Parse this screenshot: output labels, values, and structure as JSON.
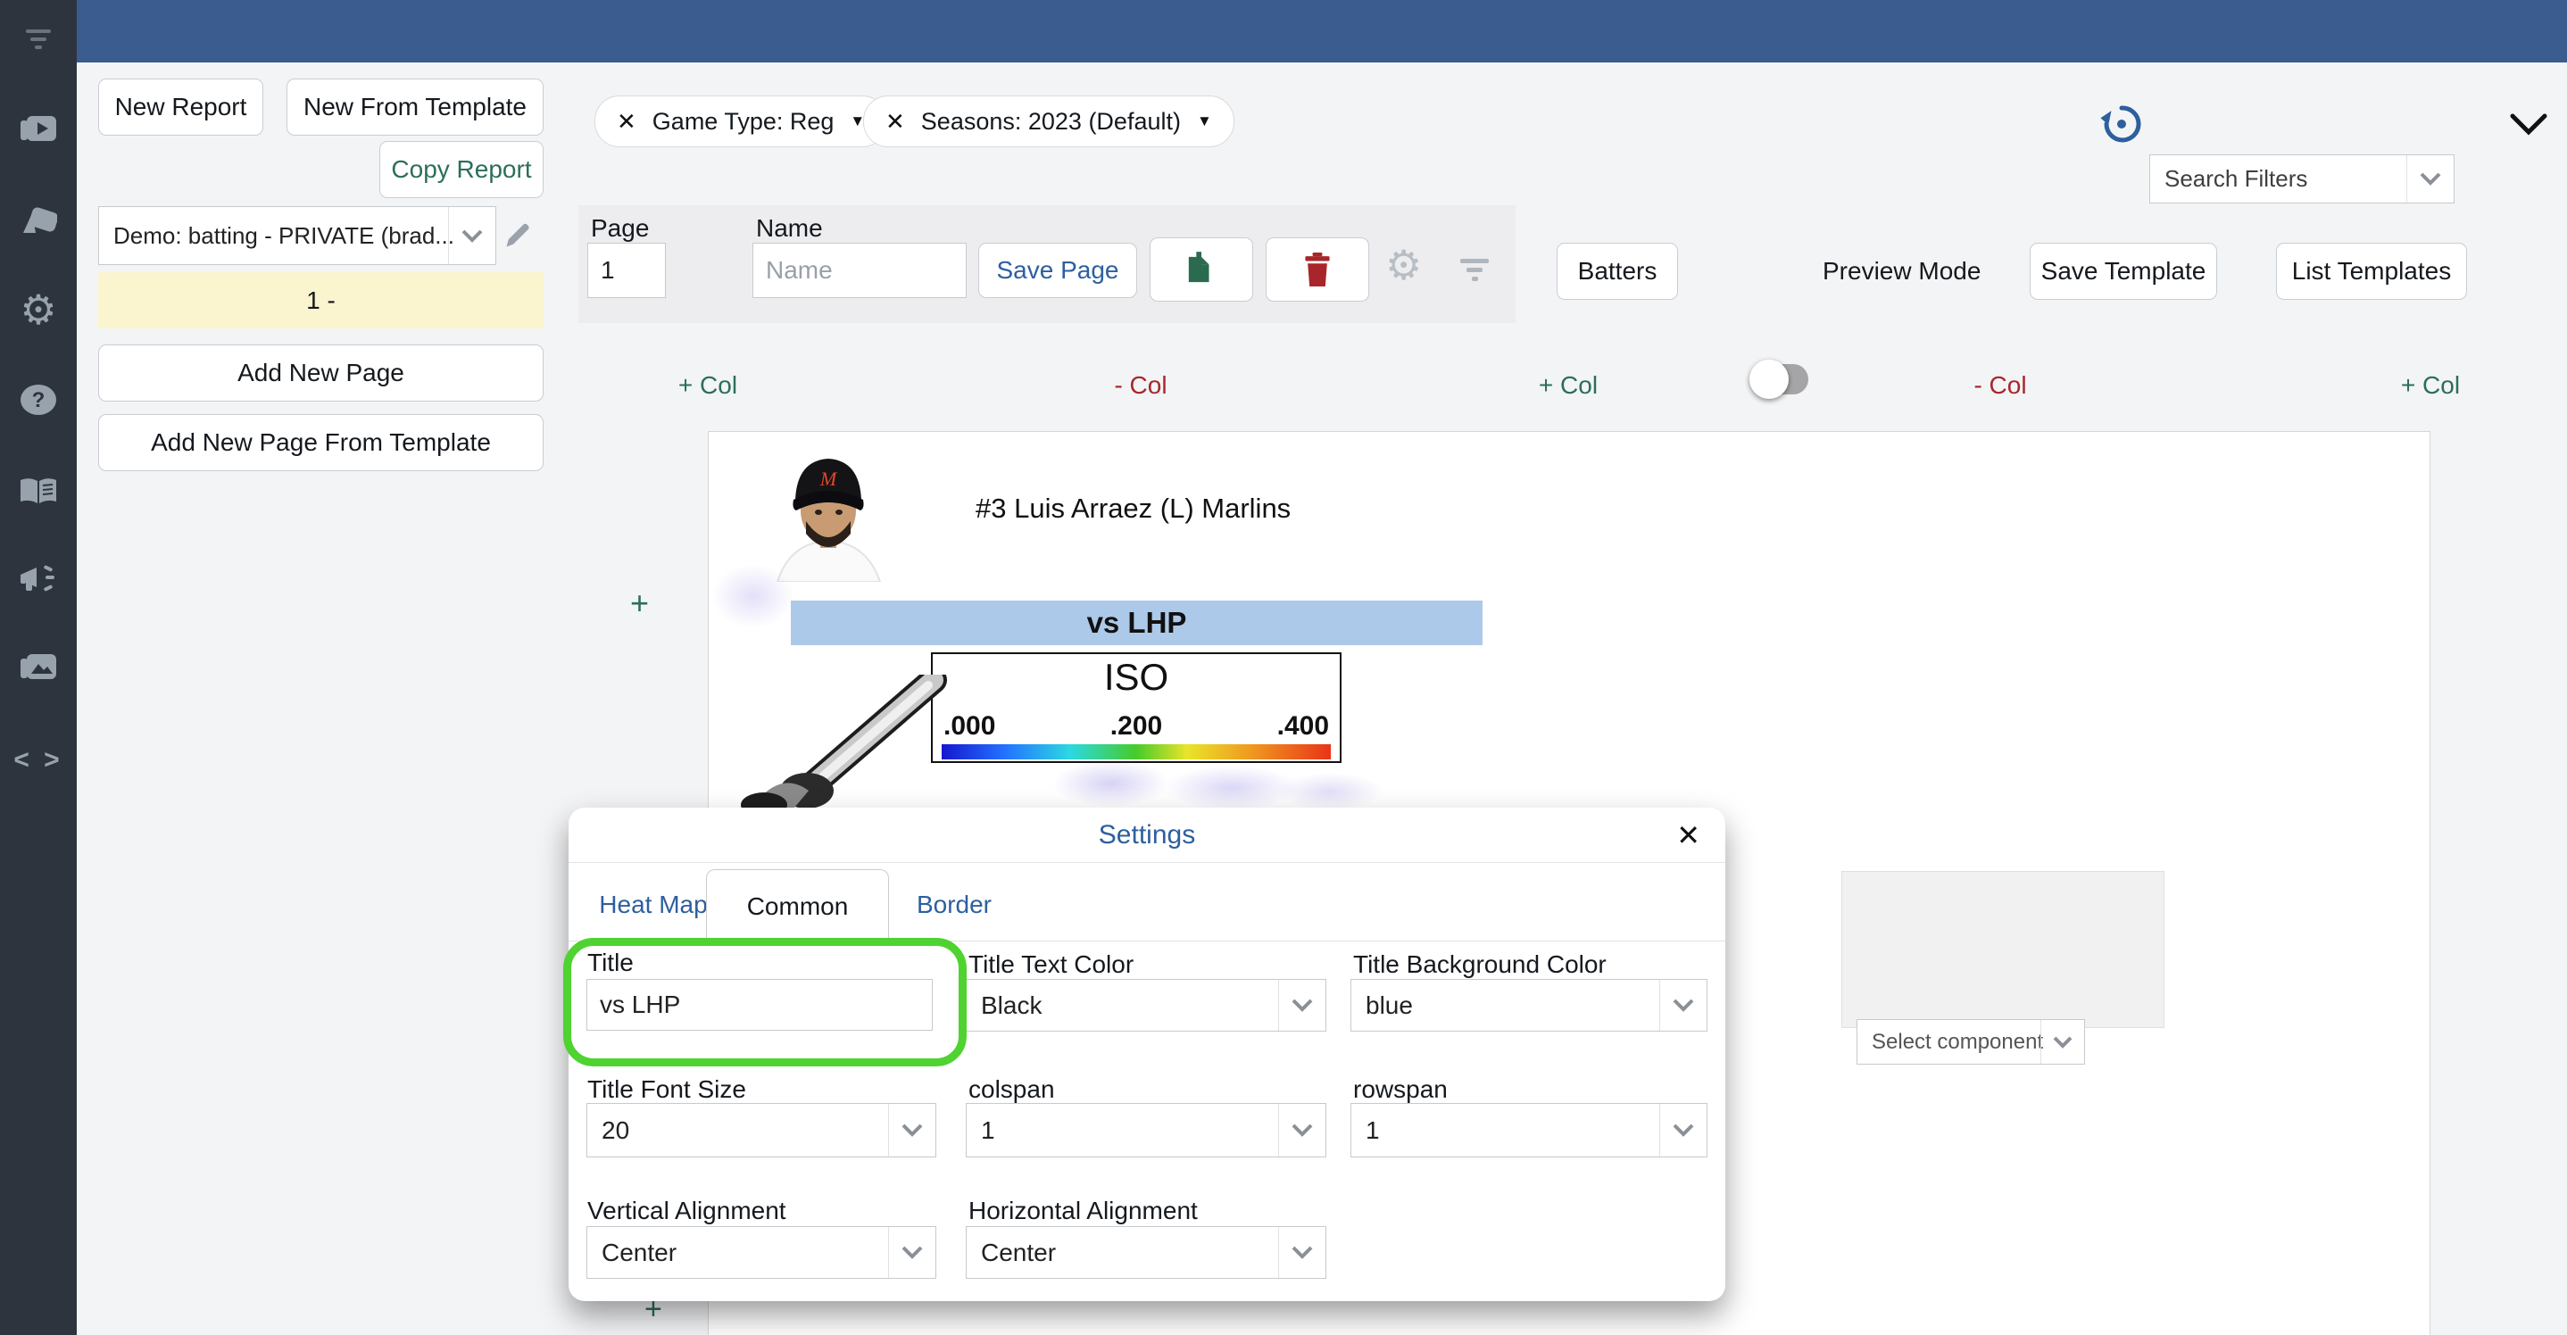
{
  "glyphs": {
    "close": "✕",
    "caret": "▼",
    "code": "< >",
    "gear": "⚙",
    "plus": "+"
  },
  "colors": {
    "topbar": "#3a5c8e",
    "sidebar": "#2e343e",
    "accent_blue": "#2d5f9e",
    "accent_green": "#2c6e5b",
    "accent_red": "#a8262b",
    "highlight_ring": "#4ed331",
    "banner_blue": "#adc9e9",
    "selected_page_yellow": "#faf4cf"
  },
  "sidebar": {
    "icons": [
      "menu-filter",
      "video-library",
      "cards-deck",
      "settings-gear",
      "help-question",
      "docs-book",
      "announcements-megaphone",
      "media-images",
      "code"
    ]
  },
  "left_panel": {
    "new_report": "New Report",
    "new_from_template": "New From Template",
    "copy_report": "Copy Report",
    "report_select_value": "Demo: batting - PRIVATE (brad...",
    "page_list_item": "1 -",
    "add_new_page": "Add New Page",
    "add_new_page_from_template": "Add New Page From Template"
  },
  "filter_bar": {
    "chips": [
      {
        "label": "Game Type: Reg"
      },
      {
        "label": "Seasons: 2023 (Default)"
      }
    ],
    "search_filters_placeholder": "Search Filters"
  },
  "page_controls": {
    "page_label": "Page",
    "page_value": "1",
    "name_label": "Name",
    "name_placeholder": "Name",
    "save_page": "Save Page",
    "batters": "Batters",
    "preview_mode": "Preview Mode",
    "save_template": "Save Template",
    "list_templates": "List Templates"
  },
  "column_controls": {
    "items": [
      {
        "label": "+ Col"
      },
      {
        "label": "- Col"
      },
      {
        "label": "+ Col"
      },
      {
        "label": "- Col"
      },
      {
        "label": "+ Col"
      }
    ]
  },
  "report": {
    "add_button": "+",
    "player_name": "#3 Luis Arraez (L) Marlins",
    "banner_title": "vs LHP",
    "legend": {
      "title": "ISO",
      "ticks": [
        ".000",
        ".200",
        ".400"
      ]
    },
    "component_picker": {
      "placeholder": "Select component"
    }
  },
  "modal": {
    "title": "Settings",
    "tabs": [
      {
        "label": "Heat Map"
      },
      {
        "label": "Common",
        "active": true
      },
      {
        "label": "Border"
      }
    ],
    "fields": {
      "title": {
        "label": "Title",
        "value": "vs LHP"
      },
      "title_text_color": {
        "label": "Title Text Color",
        "value": "Black"
      },
      "title_bg_color": {
        "label": "Title Background Color",
        "value": "blue"
      },
      "title_font_size": {
        "label": "Title Font Size",
        "value": "20"
      },
      "colspan": {
        "label": "colspan",
        "value": "1"
      },
      "rowspan": {
        "label": "rowspan",
        "value": "1"
      },
      "vertical_alignment": {
        "label": "Vertical Alignment",
        "value": "Center"
      },
      "horizontal_alignment": {
        "label": "Horizontal Alignment",
        "value": "Center"
      }
    }
  }
}
